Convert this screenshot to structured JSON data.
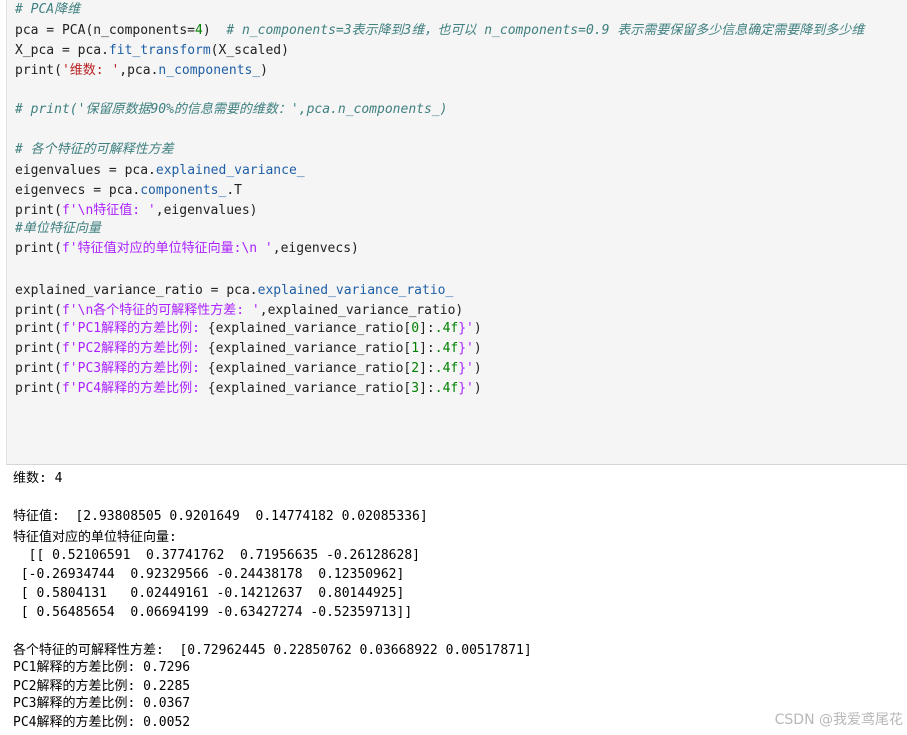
{
  "code_cell": {
    "lines": [
      {
        "segments": [
          [
            "# PCA降维",
            "cm"
          ]
        ]
      },
      {
        "segments": [
          [
            "pca = PCA(n_components=",
            ""
          ],
          [
            "4",
            "nm"
          ],
          [
            ")  ",
            ""
          ],
          [
            "# n_components=3表示降到3维，也可以 n_components=0.9 表示需要保留多少信息确定需要降到多少维",
            "cm"
          ]
        ]
      },
      {
        "segments": [
          [
            "X_pca = pca.",
            ""
          ],
          [
            "fit_transform",
            "at"
          ],
          [
            "(X_scaled)",
            ""
          ]
        ]
      },
      {
        "segments": [
          [
            "print(",
            ""
          ],
          [
            "'维数: '",
            "st"
          ],
          [
            ",pca.",
            ""
          ],
          [
            "n_components_",
            "at"
          ],
          [
            ")",
            ""
          ]
        ]
      },
      {
        "segments": []
      },
      {
        "segments": [
          [
            "# print('保留原数据90%的信息需要的维数：',pca.n_components_)",
            "cm"
          ]
        ]
      },
      {
        "segments": []
      },
      {
        "segments": [
          [
            "# 各个特征的可解释性方差",
            "cm"
          ]
        ]
      },
      {
        "segments": [
          [
            "eigenvalues = pca.",
            ""
          ],
          [
            "explained_variance_",
            "at"
          ]
        ]
      },
      {
        "segments": [
          [
            "eigenvecs = pca.",
            ""
          ],
          [
            "components_",
            "at"
          ],
          [
            ".T",
            ""
          ]
        ]
      },
      {
        "segments": [
          [
            "print(",
            ""
          ],
          [
            "f'\\n特征值: '",
            "fs"
          ],
          [
            ",eigenvalues)",
            ""
          ]
        ]
      },
      {
        "segments": [
          [
            "#单位特征向量",
            "cm"
          ]
        ]
      },
      {
        "segments": [
          [
            "print(",
            ""
          ],
          [
            "f'特征值对应的单位特征向量:\\n '",
            "fs"
          ],
          [
            ",eigenvecs)",
            ""
          ]
        ]
      },
      {
        "segments": []
      },
      {
        "segments": [
          [
            "explained_variance_ratio = pca.",
            ""
          ],
          [
            "explained_variance_ratio_",
            "at"
          ]
        ]
      },
      {
        "segments": [
          [
            "print(",
            ""
          ],
          [
            "f'\\n各个特征的可解释性方差: '",
            "fs"
          ],
          [
            ",explained_variance_ratio)",
            ""
          ]
        ]
      },
      {
        "segments": [
          [
            "print(",
            ""
          ],
          [
            "f'PC1解释的方差比例: ",
            "fs"
          ],
          [
            "{explained_variance_ratio[",
            ""
          ],
          [
            "0",
            "nm"
          ],
          [
            "]:",
            ""
          ],
          [
            ".4f",
            "nm"
          ],
          [
            "}'",
            "fs"
          ],
          [
            ")",
            ""
          ]
        ]
      },
      {
        "segments": [
          [
            "print(",
            ""
          ],
          [
            "f'PC2解释的方差比例: ",
            "fs"
          ],
          [
            "{explained_variance_ratio[",
            ""
          ],
          [
            "1",
            "nm"
          ],
          [
            "]:",
            ""
          ],
          [
            ".4f",
            "nm"
          ],
          [
            "}'",
            "fs"
          ],
          [
            ")",
            ""
          ]
        ]
      },
      {
        "segments": [
          [
            "print(",
            ""
          ],
          [
            "f'PC3解释的方差比例: ",
            "fs"
          ],
          [
            "{explained_variance_ratio[",
            ""
          ],
          [
            "2",
            "nm"
          ],
          [
            "]:",
            ""
          ],
          [
            ".4f",
            "nm"
          ],
          [
            "}'",
            "fs"
          ],
          [
            ")",
            ""
          ]
        ]
      },
      {
        "segments": [
          [
            "print(",
            ""
          ],
          [
            "f'PC4解释的方差比例: ",
            "fs"
          ],
          [
            "{explained_variance_ratio[",
            ""
          ],
          [
            "3",
            "nm"
          ],
          [
            "]:",
            ""
          ],
          [
            ".4f",
            "nm"
          ],
          [
            "}'",
            "fs"
          ],
          [
            ")",
            ""
          ]
        ]
      }
    ]
  },
  "output": {
    "lines": [
      "维数: 4",
      "",
      "特征值:  [2.93808505 0.9201649  0.14774182 0.02085336]",
      "特征值对应的单位特征向量:",
      "  [[ 0.52106591  0.37741762  0.71956635 -0.26128628]",
      " [-0.26934744  0.92329566 -0.24438178  0.12350962]",
      " [ 0.5804131   0.02449161 -0.14212637  0.80144925]",
      " [ 0.56485654  0.06694199 -0.63427274 -0.52359713]]",
      "",
      "各个特征的可解释性方差:  [0.72962445 0.22850762 0.03668922 0.00517871]",
      "PC1解释的方差比例: 0.7296",
      "PC2解释的方差比例: 0.2285",
      "PC3解释的方差比例: 0.0367",
      "PC4解释的方差比例: 0.0052"
    ]
  },
  "watermark": "CSDN @我爱鸢尾花"
}
